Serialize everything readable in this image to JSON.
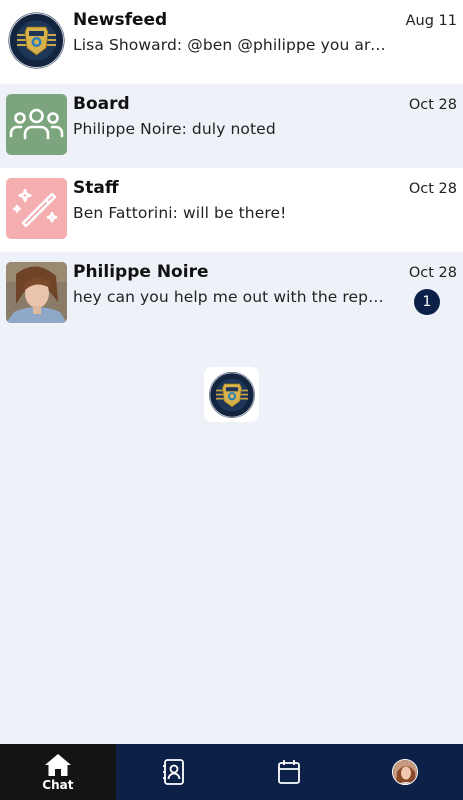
{
  "conversations": [
    {
      "title": "Newsfeed",
      "preview": "Lisa Showard: @ben @philippe you are going to…",
      "date": "Aug 11",
      "icon": "police-badge-logo",
      "bg": "#ffffff"
    },
    {
      "title": "Board",
      "preview": "Philippe Noire: duly noted",
      "date": "Oct 28",
      "icon": "users-group-icon",
      "icon_bg": "#7ca57e"
    },
    {
      "title": "Staff",
      "preview": "Ben Fattorini: will be there!",
      "date": "Oct 28",
      "icon": "magic-wand-icon",
      "icon_bg": "#f4aeb0"
    },
    {
      "title": "Philippe Noire",
      "preview": "hey can you help me out with the report?",
      "date": "Oct 28",
      "icon": "user-photo",
      "unread": "1"
    }
  ],
  "center_logo": "police-badge-logo",
  "bottom_nav": {
    "items": [
      {
        "icon": "home-icon",
        "label": "Chat",
        "active": true
      },
      {
        "icon": "contacts-icon",
        "label": ""
      },
      {
        "icon": "calendar-icon",
        "label": ""
      },
      {
        "icon": "profile-avatar",
        "label": ""
      }
    ]
  },
  "colors": {
    "nav_bg": "#0d2148",
    "nav_active_bg": "#141414",
    "list_bg": "#eef1f7",
    "badge_bg": "#0d2148",
    "board_icon_bg": "#7ca57e",
    "staff_icon_bg": "#f4aeb0"
  }
}
